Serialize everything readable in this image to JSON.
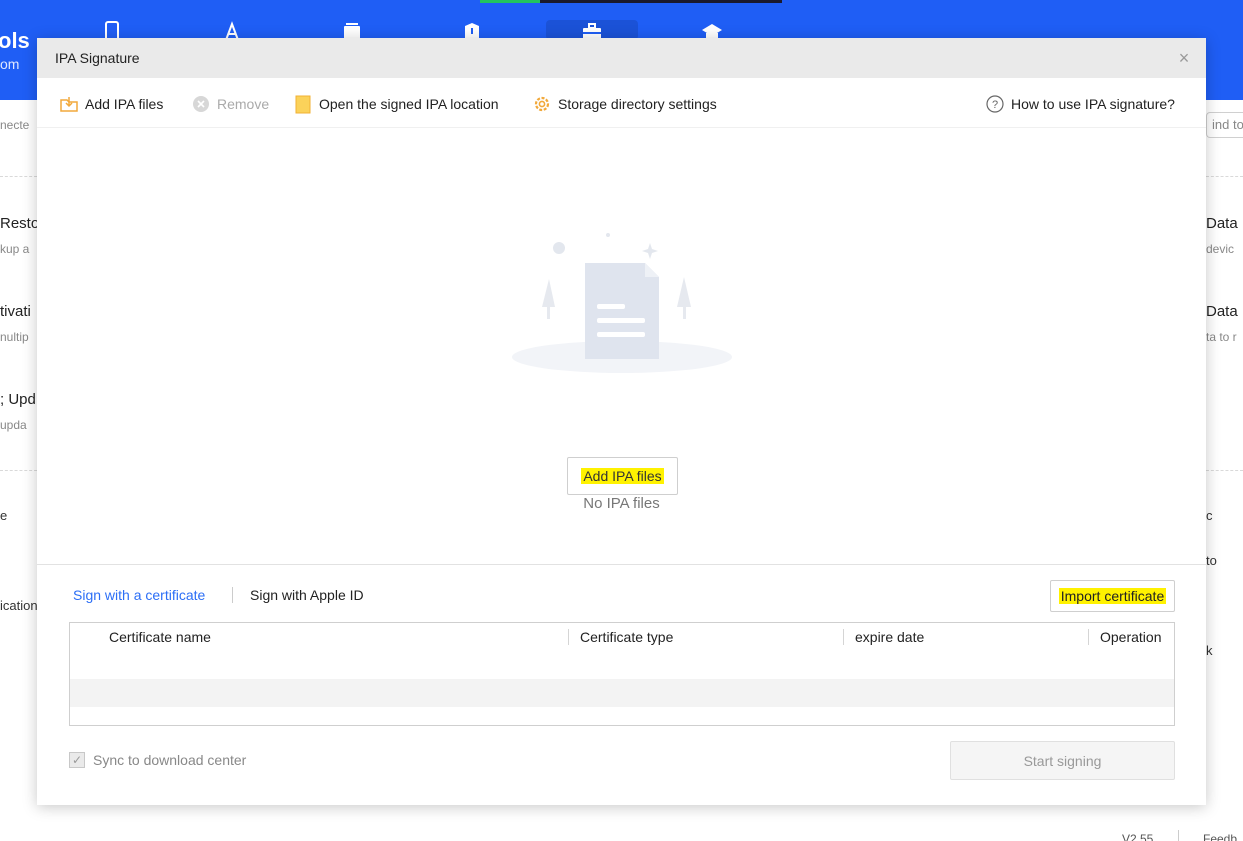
{
  "background_app": {
    "logo_title": "ols",
    "logo_sub": "om",
    "left_items": [
      {
        "main": "",
        "sub": "necte"
      },
      {
        "main": "Resto",
        "sub": "kup a"
      },
      {
        "main": "tivati",
        "sub": "nultip"
      },
      {
        "main": "; Upd",
        "sub": "upda"
      },
      {
        "main": "e",
        "sub": ""
      },
      {
        "main": "ication",
        "sub": ""
      }
    ],
    "right_items": [
      {
        "main": "Data",
        "sub": "devic"
      },
      {
        "main": "Data",
        "sub": "ta to r"
      },
      {
        "main": "c",
        "sub": ""
      },
      {
        "main": "to",
        "sub": ""
      },
      {
        "main": "k",
        "sub": ""
      }
    ],
    "search_placeholder": "ind to",
    "version": "V2.55",
    "feedback": "Feedb"
  },
  "dialog": {
    "title": "IPA Signature",
    "close_glyph": "×",
    "toolbar": {
      "add": "Add IPA files",
      "remove": "Remove",
      "open_location": "Open the signed IPA location",
      "storage_settings": "Storage directory settings",
      "help": "How to use IPA signature?"
    },
    "empty_label": "No IPA files",
    "add_button": "Add IPA files",
    "tabs": {
      "certificate": "Sign with a certificate",
      "apple_id": "Sign with Apple ID"
    },
    "import_button": "Import certificate",
    "table": {
      "columns": [
        "Certificate name",
        "Certificate type",
        "expire date",
        "Operation"
      ],
      "rows": []
    },
    "sync_label": "Sync to download center",
    "sync_checked": true,
    "start_button": "Start signing"
  },
  "colors": {
    "brand_blue": "#1f5ef5",
    "tab_active": "#2b6ef6",
    "highlight": "#fff200",
    "icon_orange": "#f2a93b"
  }
}
